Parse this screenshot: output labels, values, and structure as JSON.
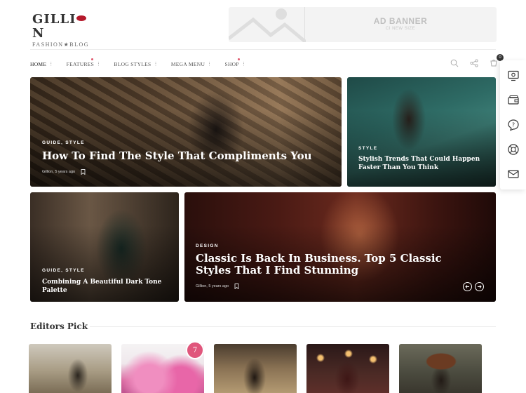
{
  "header": {
    "logo_main_pre": "GILLI",
    "logo_main_post": "N",
    "logo_sub": "FASHION★BLOG",
    "ad_title": "AD BANNER",
    "ad_sub": "CI NEW SIZE"
  },
  "nav": {
    "items": [
      {
        "label": "HOME"
      },
      {
        "label": "FEATURES"
      },
      {
        "label": "BLOG STYLES"
      },
      {
        "label": "MEGA MENU"
      },
      {
        "label": "SHOP"
      }
    ],
    "cart_count": "0"
  },
  "posts": [
    {
      "category": "GUIDE, STYLE",
      "title": "How To Find The Style That Compliments You",
      "meta": "Gillion, 5 years ago"
    },
    {
      "category": "STYLE",
      "title": "Stylish Trends That Could Happen Faster Than You Think"
    },
    {
      "category": "GUIDE, STYLE",
      "title": "Combining A Beautiful Dark Tone Palette"
    },
    {
      "category": "DESIGN",
      "title": "Classic Is Back In Business. Top 5 Classic Styles That I Find Stunning",
      "meta": "Gillion, 5 years ago"
    }
  ],
  "editors_pick": {
    "title": "Editors Pick",
    "bubble_count": "7"
  },
  "colors": {
    "accent": "#e0567c",
    "logo_red": "#b5192b"
  }
}
